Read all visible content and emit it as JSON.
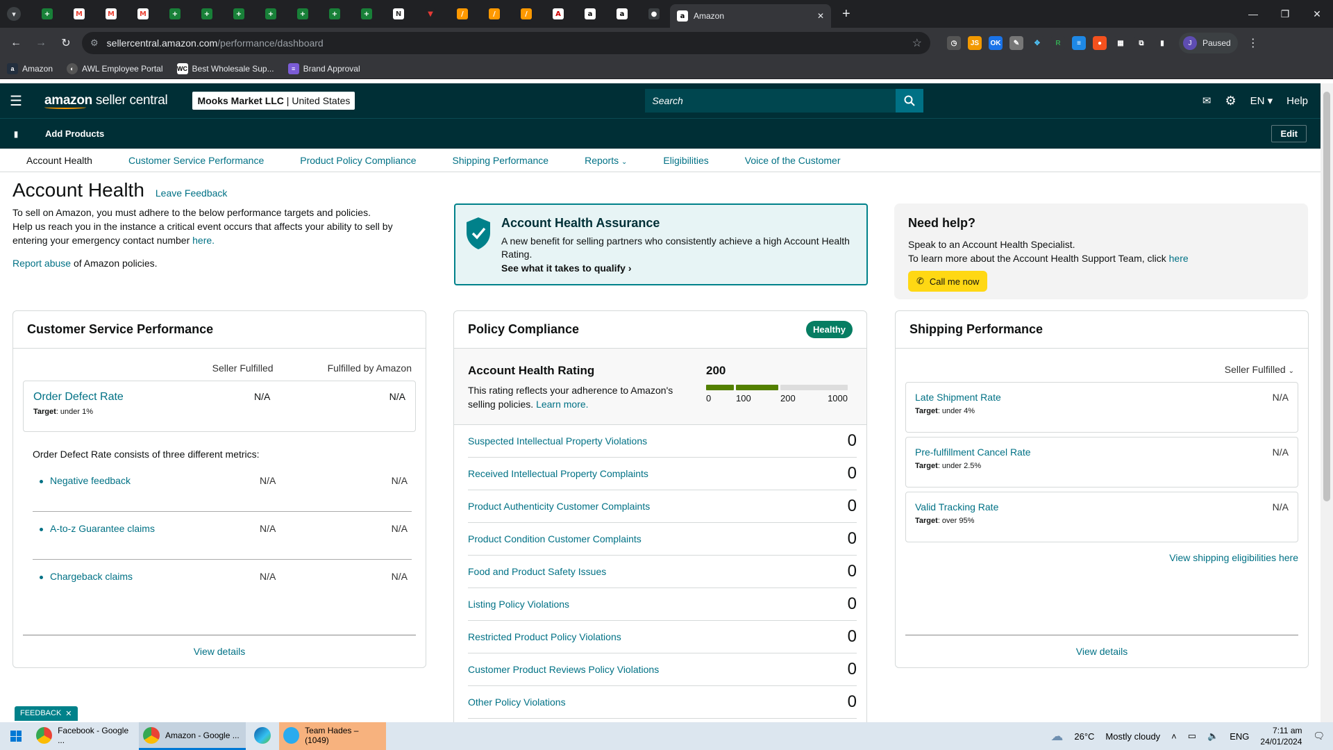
{
  "browser": {
    "active_tab_title": "Amazon",
    "url_host": "sellercentral.amazon.com",
    "url_path": "/performance/dashboard",
    "profile_status": "Paused",
    "profile_initial": "J",
    "bookmarks": [
      {
        "label": "Amazon",
        "icon": "amazon-icon",
        "color": "#232f3e"
      },
      {
        "label": "AWL Employee Portal",
        "icon": "globe-icon",
        "color": "#555"
      },
      {
        "label": "Best Wholesale Sup...",
        "icon": "wc-icon",
        "color": "#fff"
      },
      {
        "label": "Brand Approval",
        "icon": "list-icon",
        "color": "#7b5cd6"
      }
    ]
  },
  "header": {
    "logo_text_bold": "amazon",
    "logo_text": " seller central",
    "account_name": "Mooks Market LLC",
    "marketplace": "United States",
    "search_placeholder": "Search",
    "language": "EN",
    "help": "Help",
    "add_products": "Add Products",
    "edit": "Edit"
  },
  "subnav": {
    "items": [
      "Account Health",
      "Customer Service Performance",
      "Product Policy Compliance",
      "Shipping Performance",
      "Reports",
      "Eligibilities",
      "Voice of the Customer"
    ]
  },
  "page": {
    "title": "Account Health",
    "leave_feedback": "Leave Feedback",
    "intro_1": "To sell on Amazon, you must adhere to the below performance targets and policies.",
    "intro_2": "Help us reach you in the instance a critical event occurs that affects your ability to sell by entering your emergency contact number ",
    "intro_here": "here.",
    "report_abuse": "Report abuse",
    "report_abuse_suffix": " of Amazon policies."
  },
  "assurance": {
    "title": "Account Health Assurance",
    "text": "A new benefit for selling partners who consistently achieve a high Account Health Rating.",
    "cta": "See what it takes to qualify"
  },
  "need_help": {
    "title": "Need help?",
    "line1": "Speak to an Account Health Specialist.",
    "line2": "To learn more about the Account Health Support Team, click ",
    "here": "here",
    "call": "Call me now"
  },
  "customer_service": {
    "title": "Customer Service Performance",
    "col1": "Seller Fulfilled",
    "col2": "Fulfilled by Amazon",
    "odr_name": "Order Defect Rate",
    "odr_target_label": "Target",
    "odr_target": ": under 1%",
    "odr_sf": "N/A",
    "odr_fba": "N/A",
    "odr_desc": "Order Defect Rate consists of three different metrics:",
    "metrics": [
      {
        "name": "Negative feedback",
        "sf": "N/A",
        "fba": "N/A"
      },
      {
        "name": "A-to-z Guarantee claims",
        "sf": "N/A",
        "fba": "N/A"
      },
      {
        "name": "Chargeback claims",
        "sf": "N/A",
        "fba": "N/A"
      }
    ],
    "view_details": "View details"
  },
  "policy": {
    "title": "Policy Compliance",
    "status": "Healthy",
    "rating_title": "Account Health Rating",
    "rating_text": "This rating reflects your adherence to Amazon's selling policies. ",
    "learn_more": "Learn more.",
    "score": "200",
    "score_value": 200,
    "scale_labels": [
      "0",
      "100",
      "200",
      "1000"
    ],
    "violations": [
      {
        "name": "Suspected Intellectual Property Violations",
        "count": "0"
      },
      {
        "name": "Received Intellectual Property Complaints",
        "count": "0"
      },
      {
        "name": "Product Authenticity Customer Complaints",
        "count": "0"
      },
      {
        "name": "Product Condition Customer Complaints",
        "count": "0"
      },
      {
        "name": "Food and Product Safety Issues",
        "count": "0"
      },
      {
        "name": "Listing Policy Violations",
        "count": "0"
      },
      {
        "name": "Restricted Product Policy Violations",
        "count": "0"
      },
      {
        "name": "Customer Product Reviews Policy Violations",
        "count": "0"
      },
      {
        "name": "Other Policy Violations",
        "count": "0"
      }
    ]
  },
  "shipping": {
    "title": "Shipping Performance",
    "filter": "Seller Fulfilled",
    "metrics": [
      {
        "name": "Late Shipment Rate",
        "target_label": "Target",
        "target": ": under 4%",
        "value": "N/A"
      },
      {
        "name": "Pre-fulfillment Cancel Rate",
        "target_label": "Target",
        "target": ": under 2.5%",
        "value": "N/A"
      },
      {
        "name": "Valid Tracking Rate",
        "target_label": "Target",
        "target": ": over 95%",
        "value": "N/A"
      }
    ],
    "view_eligibilities": "View shipping eligibilities here",
    "view_details": "View details"
  },
  "feedback_tab": "FEEDBACK",
  "taskbar": {
    "apps": [
      {
        "label": "Facebook - Google ..."
      },
      {
        "label": "Amazon - Google ..."
      },
      {
        "label": "Team Hades – (1049)"
      }
    ],
    "weather_temp": "26°C",
    "weather_desc": "Mostly cloudy",
    "lang": "ENG",
    "time": "7:11 am",
    "date": "24/01/2024"
  },
  "colors": {
    "header_bg": "#002f36",
    "link": "#007185",
    "healthy": "#067d62",
    "call_button": "#ffd814"
  }
}
